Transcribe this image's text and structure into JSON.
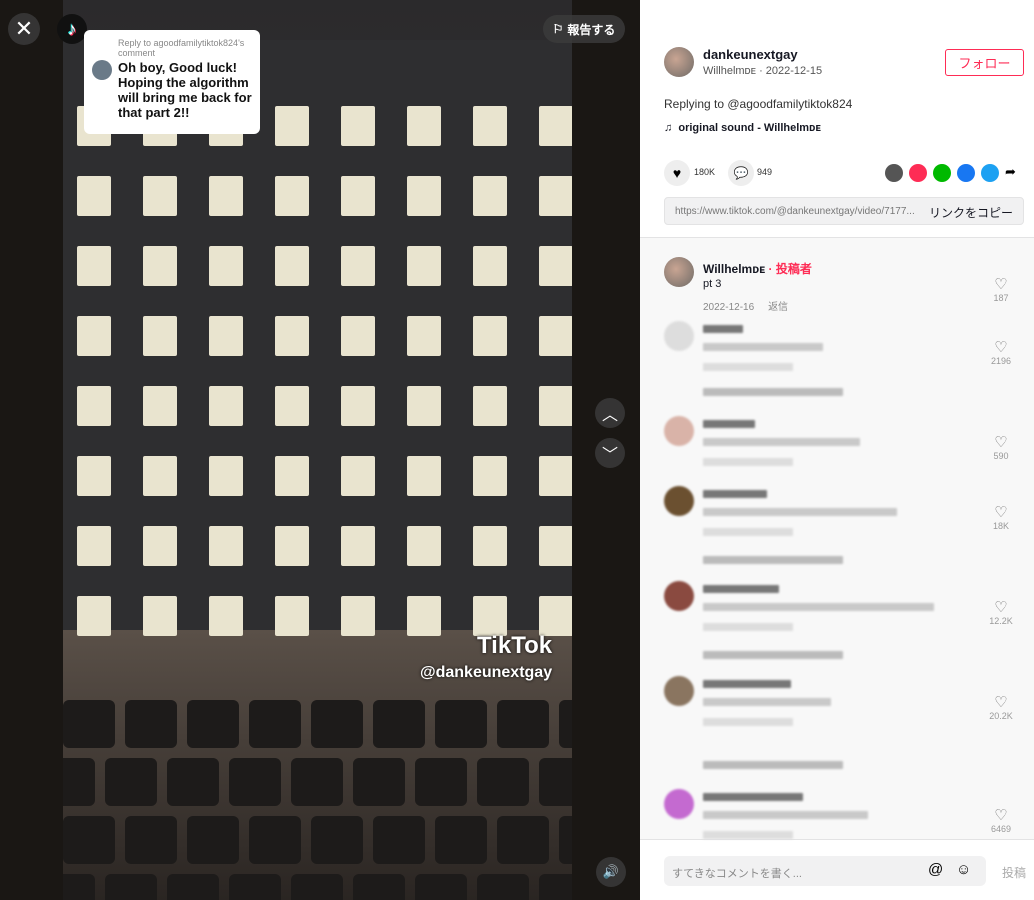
{
  "video": {
    "report_label": "報告する",
    "tiktok_logo": "TikTok",
    "watermark_user": "@dankeunextgay",
    "reply_bubble": {
      "header": "Reply to agoodfamilytiktok824's comment",
      "text": "Oh boy, Good luck! Hoping the algorithm will bring me back for that part 2!!"
    }
  },
  "post": {
    "username": "dankeunextgay",
    "nickname": "Willhelmᴅᴇ",
    "date": "2022-12-15",
    "follow_label": "フォロー",
    "caption": "Replying to @agoodfamilytiktok824",
    "sound": "original sound - Willhelmᴅᴇ",
    "likes": "180K",
    "comments": "949",
    "url": "https://www.tiktok.com/@dankeunextgay/video/7177...",
    "copy_link_label": "リンクをコピー"
  },
  "comments": [
    {
      "author": "Willhelmᴅᴇ",
      "badge": "· 投稿者",
      "text": "pt 3",
      "date": "2022-12-16",
      "reply_label": "返信",
      "likes": "187"
    },
    {
      "likes": "2196"
    },
    {
      "likes": "590"
    },
    {
      "likes": "18K"
    },
    {
      "likes": "12.2K"
    },
    {
      "likes": "20.2K"
    },
    {
      "likes": "6469"
    }
  ],
  "composer": {
    "placeholder": "すてきなコメントを書く...",
    "post_label": "投稿"
  },
  "colors": {
    "accent": "#fe2c55",
    "panel_bg": "#f8f8f8"
  }
}
